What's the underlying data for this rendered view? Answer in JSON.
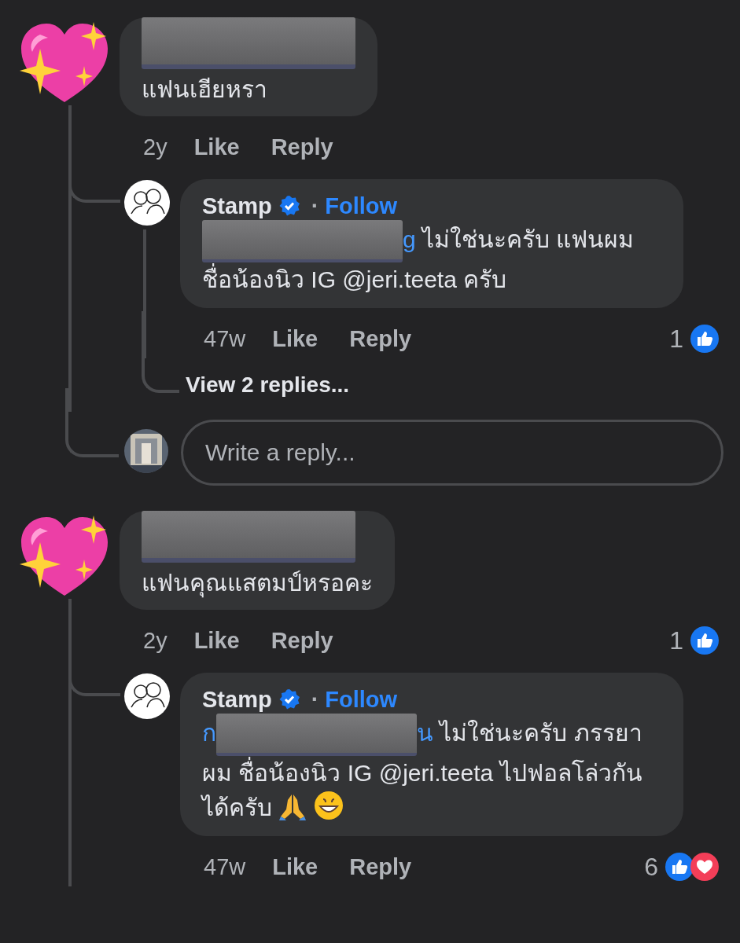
{
  "comments": [
    {
      "name_hidden": true,
      "text": "แฟนเฮียหรา",
      "time": "2y",
      "actions": [
        "Like",
        "Reply"
      ],
      "replies": [
        {
          "author": "Stamp",
          "verified": true,
          "separator": "·",
          "follow": "Follow",
          "mention": {
            "end": "g"
          },
          "text": "ไม่ใช่นะครับ แฟนผม ชื่อน้องนิว IG @jeri.teeta ครับ",
          "time": "47w",
          "actions": [
            "Like",
            "Reply"
          ],
          "reaction_count": "1",
          "reactions": [
            {
              "kind": "like"
            }
          ]
        }
      ],
      "view_replies": "View 2 replies...",
      "reply_placeholder": "Write a reply..."
    },
    {
      "name_hidden": true,
      "text": "แฟนคุณแสตมป์หรอคะ",
      "time": "2y",
      "actions": [
        "Like",
        "Reply"
      ],
      "reaction_count": "1",
      "reactions": [
        {
          "kind": "like"
        }
      ],
      "replies": [
        {
          "author": "Stamp",
          "verified": true,
          "separator": "·",
          "follow": "Follow",
          "mention": {
            "start": "ก",
            "end": "น"
          },
          "text": "ไม่ใช่นะครับ ภรรยาผม ชื่อน้องนิว IG @jeri.teeta ไปฟอลโล่วกันได้ครับ",
          "emojis": [
            {
              "kind": "pray"
            },
            {
              "kind": "grin"
            }
          ],
          "time": "47w",
          "actions": [
            "Like",
            "Reply"
          ],
          "reaction_count": "6",
          "reactions": [
            {
              "kind": "like"
            },
            {
              "kind": "love"
            }
          ]
        }
      ]
    }
  ]
}
